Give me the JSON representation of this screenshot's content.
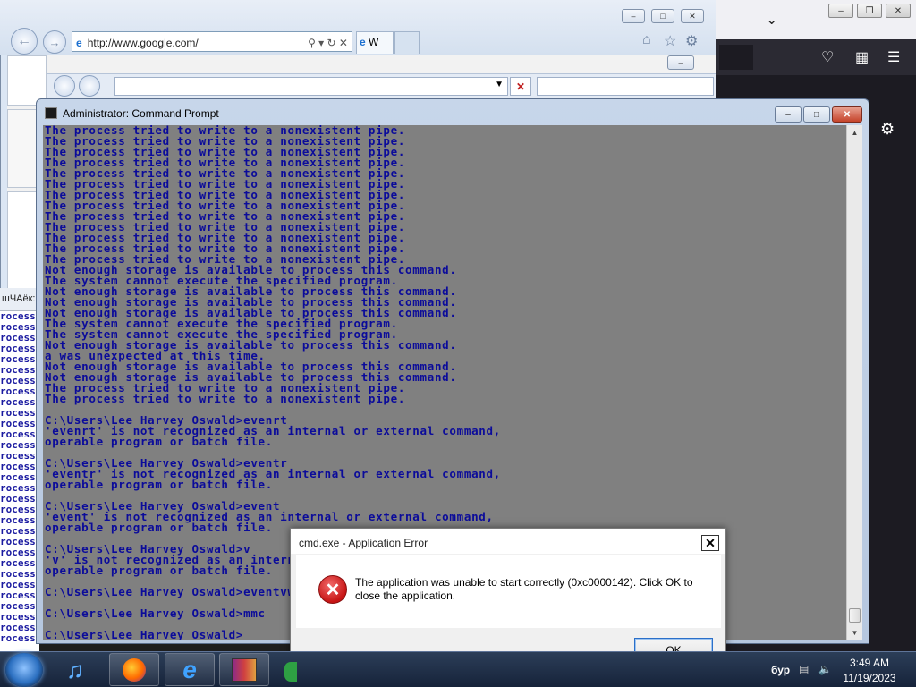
{
  "ie": {
    "url": "http://www.google.com/",
    "tab_label": "W"
  },
  "bg_console": {
    "title": "шЧАёк:",
    "line_text": "rocess"
  },
  "cmd": {
    "title": "Administrator: Command Prompt",
    "lines": [
      "The process tried to write to a nonexistent pipe.",
      "The process tried to write to a nonexistent pipe.",
      "The process tried to write to a nonexistent pipe.",
      "The process tried to write to a nonexistent pipe.",
      "The process tried to write to a nonexistent pipe.",
      "The process tried to write to a nonexistent pipe.",
      "The process tried to write to a nonexistent pipe.",
      "The process tried to write to a nonexistent pipe.",
      "The process tried to write to a nonexistent pipe.",
      "The process tried to write to a nonexistent pipe.",
      "The process tried to write to a nonexistent pipe.",
      "The process tried to write to a nonexistent pipe.",
      "The process tried to write to a nonexistent pipe.",
      "Not enough storage is available to process this command.",
      "The system cannot execute the specified program.",
      "Not enough storage is available to process this command.",
      "Not enough storage is available to process this command.",
      "Not enough storage is available to process this command.",
      "The system cannot execute the specified program.",
      "The system cannot execute the specified program.",
      "Not enough storage is available to process this command.",
      "a was unexpected at this time.",
      "Not enough storage is available to process this command.",
      "Not enough storage is available to process this command.",
      "The process tried to write to a nonexistent pipe.",
      "The process tried to write to a nonexistent pipe.",
      "",
      "C:\\Users\\Lee Harvey Oswald>evenrt",
      "'evenrt' is not recognized as an internal or external command,",
      "operable program or batch file.",
      "",
      "C:\\Users\\Lee Harvey Oswald>eventr",
      "'eventr' is not recognized as an internal or external command,",
      "operable program or batch file.",
      "",
      "C:\\Users\\Lee Harvey Oswald>event",
      "'event' is not recognized as an internal or external command,",
      "operable program or batch file.",
      "",
      "C:\\Users\\Lee Harvey Oswald>v",
      "'v' is not recognized as an interna",
      "operable program or batch file.",
      "",
      "C:\\Users\\Lee Harvey Oswald>eventvwr",
      "",
      "C:\\Users\\Lee Harvey Oswald>mmc",
      "",
      "C:\\Users\\Lee Harvey Oswald>_"
    ]
  },
  "error_dialog": {
    "title": "cmd.exe - Application Error",
    "close_glyph": "✕",
    "message": "The application was unable to start correctly (0xc0000142). Click OK to close the application.",
    "ok_label": "OK"
  },
  "taskbar": {
    "lang": "бур",
    "time": "3:49 AM",
    "date": "11/19/2023"
  },
  "colors": {
    "console_bg": "#808080",
    "console_text": "#0b0b9a",
    "taskbar": "#1f3049"
  }
}
